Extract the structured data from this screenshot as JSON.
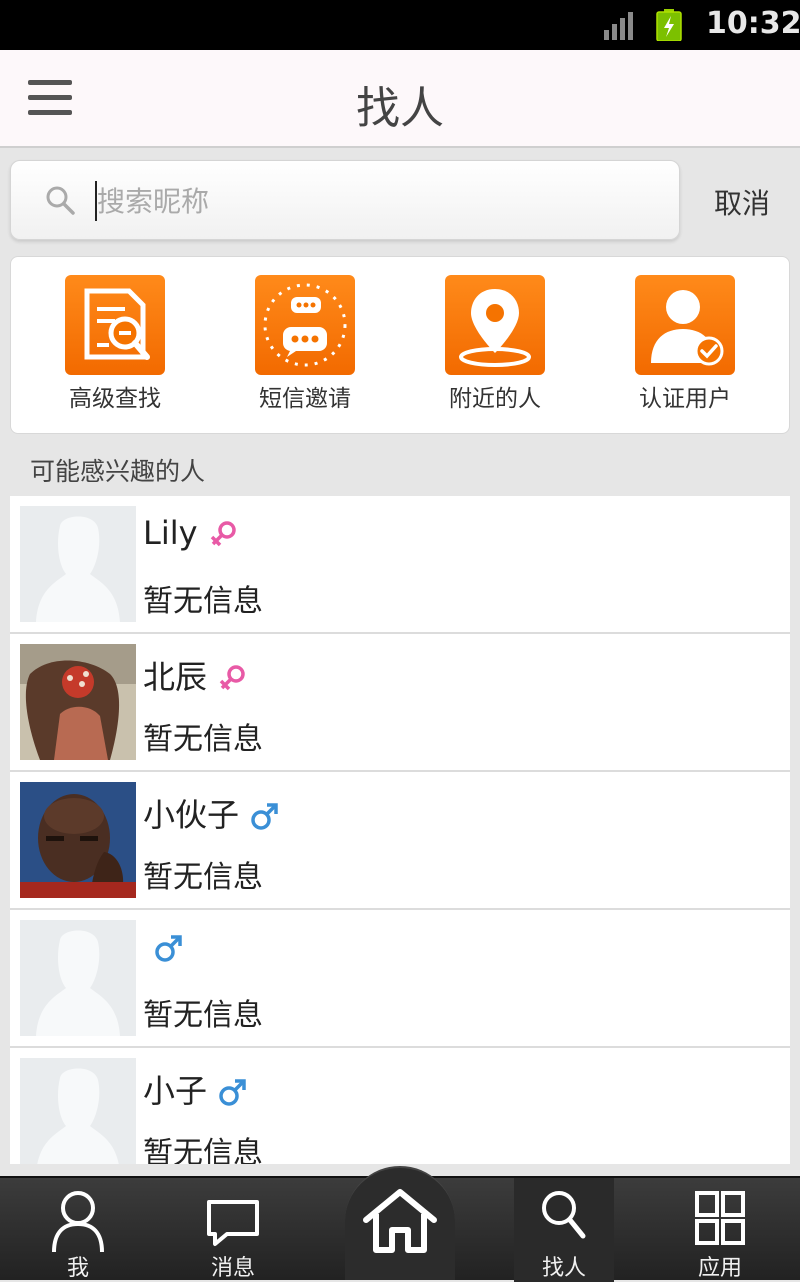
{
  "status_bar": {
    "time": "10:32"
  },
  "header": {
    "title": "找人"
  },
  "search": {
    "placeholder": "搜索昵称",
    "value": "",
    "cancel_label": "取消"
  },
  "quick_actions": [
    {
      "label": "高级查找",
      "icon": "advanced-search-icon"
    },
    {
      "label": "短信邀请",
      "icon": "sms-invite-icon"
    },
    {
      "label": "附近的人",
      "icon": "location-pin-icon"
    },
    {
      "label": "认证用户",
      "icon": "verified-user-icon"
    }
  ],
  "section_title": "可能感兴趣的人",
  "people": [
    {
      "name": "Lily",
      "gender": "female",
      "info": "暂无信息",
      "avatar": "placeholder"
    },
    {
      "name": "北辰",
      "gender": "female",
      "info": "暂无信息",
      "avatar": "photo"
    },
    {
      "name": "小伙子",
      "gender": "male",
      "info": "暂无信息",
      "avatar": "photo"
    },
    {
      "name": "",
      "gender": "male",
      "info": "暂无信息",
      "avatar": "placeholder"
    },
    {
      "name": "小子",
      "gender": "male",
      "info": "暂无信息",
      "avatar": "placeholder"
    }
  ],
  "tabs": [
    {
      "label": "我",
      "icon": "person-icon"
    },
    {
      "label": "消息",
      "icon": "message-icon"
    },
    {
      "label": "",
      "icon": "home-icon"
    },
    {
      "label": "找人",
      "icon": "search-icon",
      "active": true
    },
    {
      "label": "应用",
      "icon": "apps-icon"
    }
  ],
  "colors": {
    "accent_orange": "#f57300",
    "female_pink": "#e85aa6",
    "male_blue": "#3a8fd6",
    "tab_bar": "#2a2a2a"
  }
}
